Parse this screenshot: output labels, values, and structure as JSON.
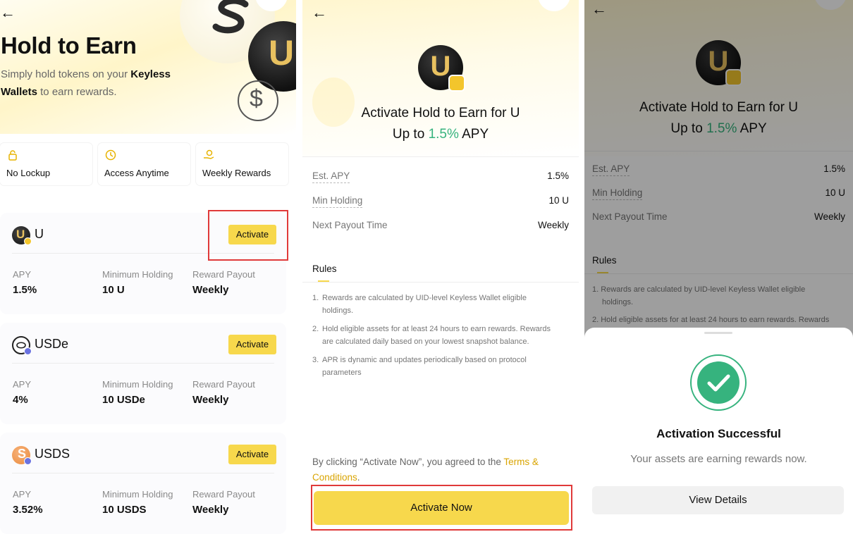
{
  "panel1": {
    "title": "Hold to Earn",
    "subtitle_pre": "Simply hold tokens on your ",
    "subtitle_bold1": "Keyless",
    "subtitle_bold2": "Wallets",
    "subtitle_post": " to earn rewards.",
    "features": [
      {
        "label": "No Lockup",
        "icon": "lock-icon"
      },
      {
        "label": "Access Anytime",
        "icon": "clock-icon"
      },
      {
        "label": "Weekly Rewards",
        "icon": "hand-coin-icon"
      }
    ],
    "tokens": [
      {
        "name": "U",
        "action": "Activate",
        "apy_label": "APY",
        "apy": "1.5%",
        "min_label": "Minimum Holding",
        "min": "10 U",
        "payout_label": "Reward Payout",
        "payout": "Weekly"
      },
      {
        "name": "USDe",
        "action": "Activate",
        "apy_label": "APY",
        "apy": "4%",
        "min_label": "Minimum Holding",
        "min": "10 USDe",
        "payout_label": "Reward Payout",
        "payout": "Weekly"
      },
      {
        "name": "USDS",
        "action": "Activate",
        "apy_label": "APY",
        "apy": "3.52%",
        "min_label": "Minimum Holding",
        "min": "10 USDS",
        "payout_label": "Reward Payout",
        "payout": "Weekly"
      }
    ]
  },
  "panel2": {
    "coin_letter": "U",
    "title": "Activate Hold to Earn for U",
    "apy_pre": "Up to ",
    "apy_value": "1.5%",
    "apy_post": " APY",
    "details": [
      {
        "label": "Est. APY",
        "value": "1.5%"
      },
      {
        "label": "Min Holding",
        "value": "10 U"
      },
      {
        "label": "Next Payout Time",
        "value": "Weekly"
      }
    ],
    "rules_title": "Rules",
    "rules": [
      {
        "n": "1.",
        "line1": "Rewards are calculated by UID-level Keyless Wallet eligible",
        "line2": "holdings."
      },
      {
        "n": "2.",
        "line1": "Hold eligible assets for at least 24 hours to earn rewards. Rewards",
        "line2": "are calculated daily based on your lowest snapshot balance."
      },
      {
        "n": "3.",
        "line1": "APR is dynamic and updates periodically based on protocol",
        "line2": "parameters"
      }
    ],
    "agree_pre": "By clicking “Activate Now”, you agreed to the ",
    "agree_link1": "Terms &",
    "agree_link2": "Conditions",
    "agree_post": ".",
    "cta": "Activate Now"
  },
  "panel3": {
    "coin_letter": "U",
    "title": "Activate Hold to Earn for U",
    "apy_pre": "Up to ",
    "apy_value": "1.5%",
    "apy_post": " APY",
    "details": [
      {
        "label": "Est. APY",
        "value": "1.5%"
      },
      {
        "label": "Min Holding",
        "value": "10 U"
      },
      {
        "label": "Next Payout Time",
        "value": "Weekly"
      }
    ],
    "rules_title": "Rules",
    "rule1_line1": "1. Rewards are calculated by UID-level Keyless Wallet eligible",
    "rule1_line2": "holdings.",
    "rule2_line1": "2. Hold eligible assets for at least 24 hours to earn rewards. Rewards",
    "success_title": "Activation Successful",
    "success_sub": "Your assets are earning rewards now.",
    "view_details": "View Details"
  },
  "colors": {
    "accent_yellow": "#f7d84c",
    "success_green": "#36b37e",
    "highlight_red": "#e03a3a",
    "link_gold": "#d9a400"
  }
}
